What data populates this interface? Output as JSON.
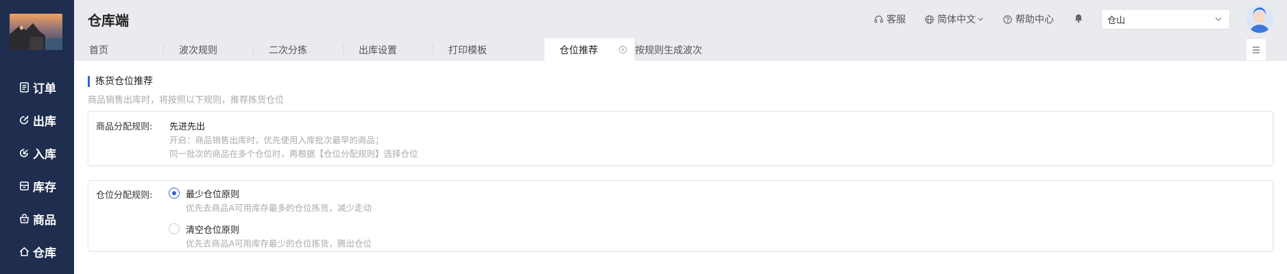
{
  "app": {
    "title": "仓库端"
  },
  "sidebar": {
    "items": [
      {
        "label": "订单",
        "icon": "document-icon"
      },
      {
        "label": "出库",
        "icon": "outbound-icon"
      },
      {
        "label": "入库",
        "icon": "inbound-icon"
      },
      {
        "label": "库存",
        "icon": "inventory-box-icon"
      },
      {
        "label": "商品",
        "icon": "shopping-bag-icon"
      },
      {
        "label": "仓库",
        "icon": "home-icon"
      }
    ]
  },
  "header": {
    "service": "客服",
    "language": "简体中文",
    "help": "帮助中心",
    "store_select_value": "仓山"
  },
  "tabs": [
    {
      "label": "首页"
    },
    {
      "label": "波次规则"
    },
    {
      "label": "二次分拣"
    },
    {
      "label": "出库设置"
    },
    {
      "label": "打印模板"
    },
    {
      "label": "仓位推荐",
      "active": true
    },
    {
      "label": "按规则生成波次"
    }
  ],
  "section": {
    "title": "拣货仓位推荐",
    "desc": "商品销售出库时，将按照以下规则，推荐拣货仓位"
  },
  "goods_rule": {
    "label": "商品分配规则:",
    "name": "先进先出",
    "line1": "开启：商品销售出库时，优先使用入库批次最早的商品；",
    "line2": "同一批次的商品在多个仓位时，再根据【仓位分配规则】选择仓位"
  },
  "location_rule": {
    "label": "仓位分配规则:",
    "options": [
      {
        "label": "最少仓位原则",
        "desc": "优先去商品A可用库存最多的仓位拣货，减少走动",
        "checked": true
      },
      {
        "label": "清空仓位原则",
        "desc": "优先去商品A可用库存最少的仓位拣货，腾出仓位",
        "checked": false
      }
    ]
  },
  "colors": {
    "sidebar_bg": "#1f2d4f",
    "accent": "#3562d8",
    "header_bg": "#e9ebef"
  }
}
